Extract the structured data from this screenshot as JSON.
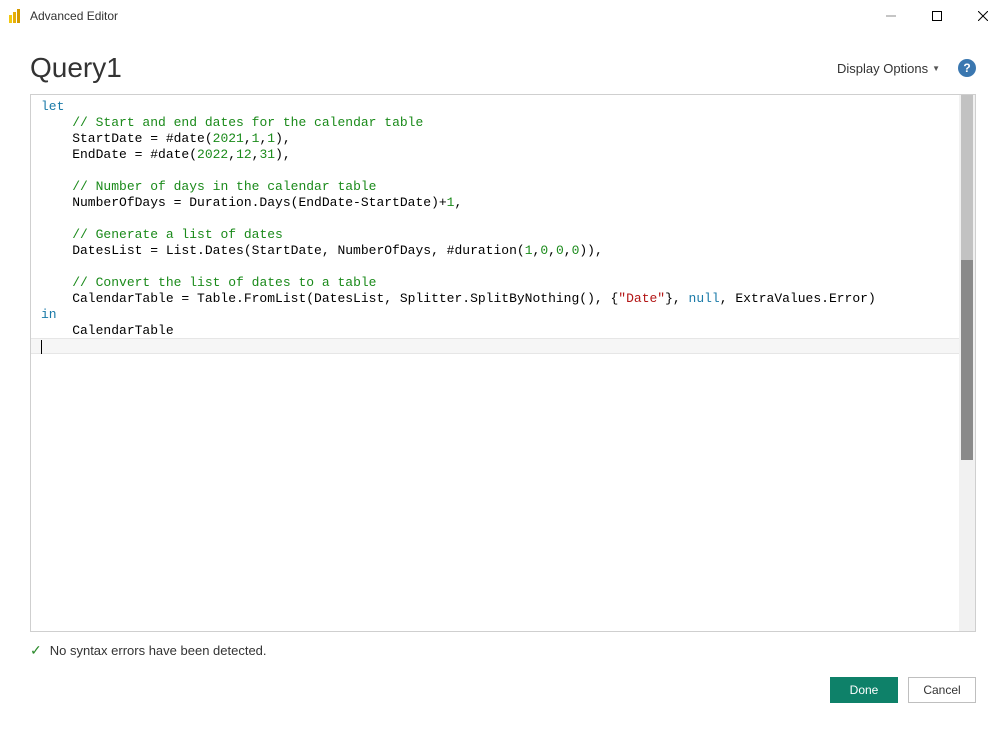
{
  "window": {
    "title": "Advanced Editor"
  },
  "header": {
    "queryName": "Query1",
    "displayOptionsLabel": "Display Options"
  },
  "code": {
    "tokens": [
      [
        {
          "t": "let",
          "c": "kw"
        }
      ],
      [
        {
          "t": "    "
        },
        {
          "t": "// Start and end dates for the calendar table",
          "c": "com"
        }
      ],
      [
        {
          "t": "    StartDate = #date("
        },
        {
          "t": "2021",
          "c": "num"
        },
        {
          "t": ","
        },
        {
          "t": "1",
          "c": "num"
        },
        {
          "t": ","
        },
        {
          "t": "1",
          "c": "num"
        },
        {
          "t": "),"
        }
      ],
      [
        {
          "t": "    EndDate = #date("
        },
        {
          "t": "2022",
          "c": "num"
        },
        {
          "t": ","
        },
        {
          "t": "12",
          "c": "num"
        },
        {
          "t": ","
        },
        {
          "t": "31",
          "c": "num"
        },
        {
          "t": "),"
        }
      ],
      [],
      [
        {
          "t": "    "
        },
        {
          "t": "// Number of days in the calendar table",
          "c": "com"
        }
      ],
      [
        {
          "t": "    NumberOfDays = Duration.Days(EndDate-StartDate)+"
        },
        {
          "t": "1",
          "c": "num"
        },
        {
          "t": ","
        }
      ],
      [],
      [
        {
          "t": "    "
        },
        {
          "t": "// Generate a list of dates",
          "c": "com"
        }
      ],
      [
        {
          "t": "    DatesList = List.Dates(StartDate, NumberOfDays, #duration("
        },
        {
          "t": "1",
          "c": "num"
        },
        {
          "t": ","
        },
        {
          "t": "0",
          "c": "num"
        },
        {
          "t": ","
        },
        {
          "t": "0",
          "c": "num"
        },
        {
          "t": ","
        },
        {
          "t": "0",
          "c": "num"
        },
        {
          "t": ")),"
        }
      ],
      [],
      [
        {
          "t": "    "
        },
        {
          "t": "// Convert the list of dates to a table",
          "c": "com"
        }
      ],
      [
        {
          "t": "    CalendarTable = Table.FromList(DatesList, Splitter.SplitByNothing(), {"
        },
        {
          "t": "\"Date\"",
          "c": "str"
        },
        {
          "t": "}, "
        },
        {
          "t": "null",
          "c": "nullkw"
        },
        {
          "t": ", ExtraValues.Error)"
        }
      ],
      [
        {
          "t": "in",
          "c": "kw"
        }
      ],
      [
        {
          "t": "    CalendarTable"
        }
      ]
    ],
    "cursorLineIndex": 15
  },
  "status": {
    "message": "No syntax errors have been detected."
  },
  "footer": {
    "doneLabel": "Done",
    "cancelLabel": "Cancel"
  },
  "help": {
    "glyph": "?"
  }
}
